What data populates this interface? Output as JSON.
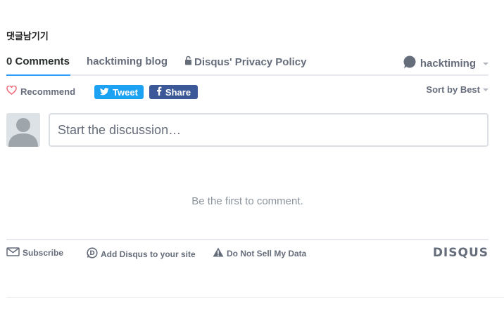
{
  "section_heading": "댓글남기기",
  "nav": {
    "tabs": [
      {
        "label": "0 Comments"
      },
      {
        "label": "hacktiming blog"
      },
      {
        "label": "Disqus' Privacy Policy"
      }
    ],
    "user_name": "hacktiming"
  },
  "actions": {
    "recommend_label": "Recommend",
    "tweet_label": "Tweet",
    "share_label": "Share",
    "sort_label": "Sort by Best"
  },
  "composer": {
    "placeholder": "Start the discussion…"
  },
  "empty_message": "Be the first to comment.",
  "footer": {
    "subscribe_label": "Subscribe",
    "add_disqus_label": "Add Disqus to your site",
    "do_not_sell_label": "Do Not Sell My Data",
    "logo_text": "DISQUS"
  },
  "colors": {
    "accent": "#2e9fff",
    "twitter": "#1da1f2",
    "facebook": "#3b5998",
    "heart": "#f05f70",
    "text_muted": "#656c7a"
  },
  "icons": [
    "lock-icon",
    "chat-bubble-icon",
    "heart-icon",
    "twitter-icon",
    "facebook-icon",
    "envelope-icon",
    "disqus-d-icon",
    "warning-icon",
    "avatar-placeholder-icon"
  ]
}
